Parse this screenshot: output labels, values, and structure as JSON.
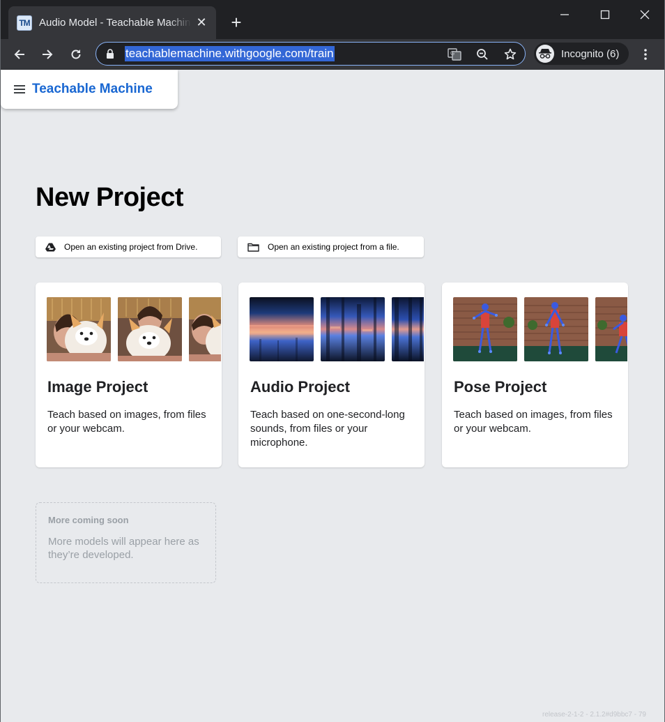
{
  "browser": {
    "tab": {
      "title": "Audio Model - Teachable Machine",
      "favicon_text": "TM",
      "close_icon": "close-icon"
    },
    "new_tab_icon": "plus-icon",
    "window_controls": [
      "minimize-icon",
      "maximize-icon",
      "close-icon"
    ],
    "nav": [
      "back-arrow-icon",
      "forward-arrow-icon",
      "reload-icon"
    ],
    "omnibox": {
      "url": "teachablemachine.withgoogle.com/train",
      "icons": [
        "lock-icon",
        "translate-icon",
        "zoom-out-icon",
        "star-icon"
      ]
    },
    "profile": {
      "label": "Incognito (6)",
      "icon": "incognito-icon"
    },
    "menu_icon": "kebab-menu-icon",
    "colors": {
      "frame": "#202124",
      "toolbar": "#35363a",
      "selection": "#3367d6",
      "focus_ring": "#8ab4f8"
    }
  },
  "app": {
    "brand": "Teachable Machine",
    "menu_icon": "hamburger-menu-icon",
    "colors": {
      "brand": "#1967d2",
      "page_bg": "#e8eaed"
    }
  },
  "page": {
    "title": "New Project",
    "open_buttons": [
      {
        "label": "Open an existing project from Drive.",
        "icon": "google-drive-icon"
      },
      {
        "label": "Open an existing project from a file.",
        "icon": "folder-icon"
      }
    ],
    "projects": [
      {
        "title": "Image Project",
        "description": "Teach based on images, from files or your webcam."
      },
      {
        "title": "Audio Project",
        "description": "Teach based on one-second-long sounds, from files or your microphone."
      },
      {
        "title": "Pose Project",
        "description": "Teach based on images, from files or your webcam."
      }
    ],
    "coming_soon": {
      "title": "More coming soon",
      "description": "More models will appear here as they’re developed."
    }
  },
  "footer": {
    "release": "release-2-1-2 - 2.1.2#d9bbc7 - 79"
  }
}
